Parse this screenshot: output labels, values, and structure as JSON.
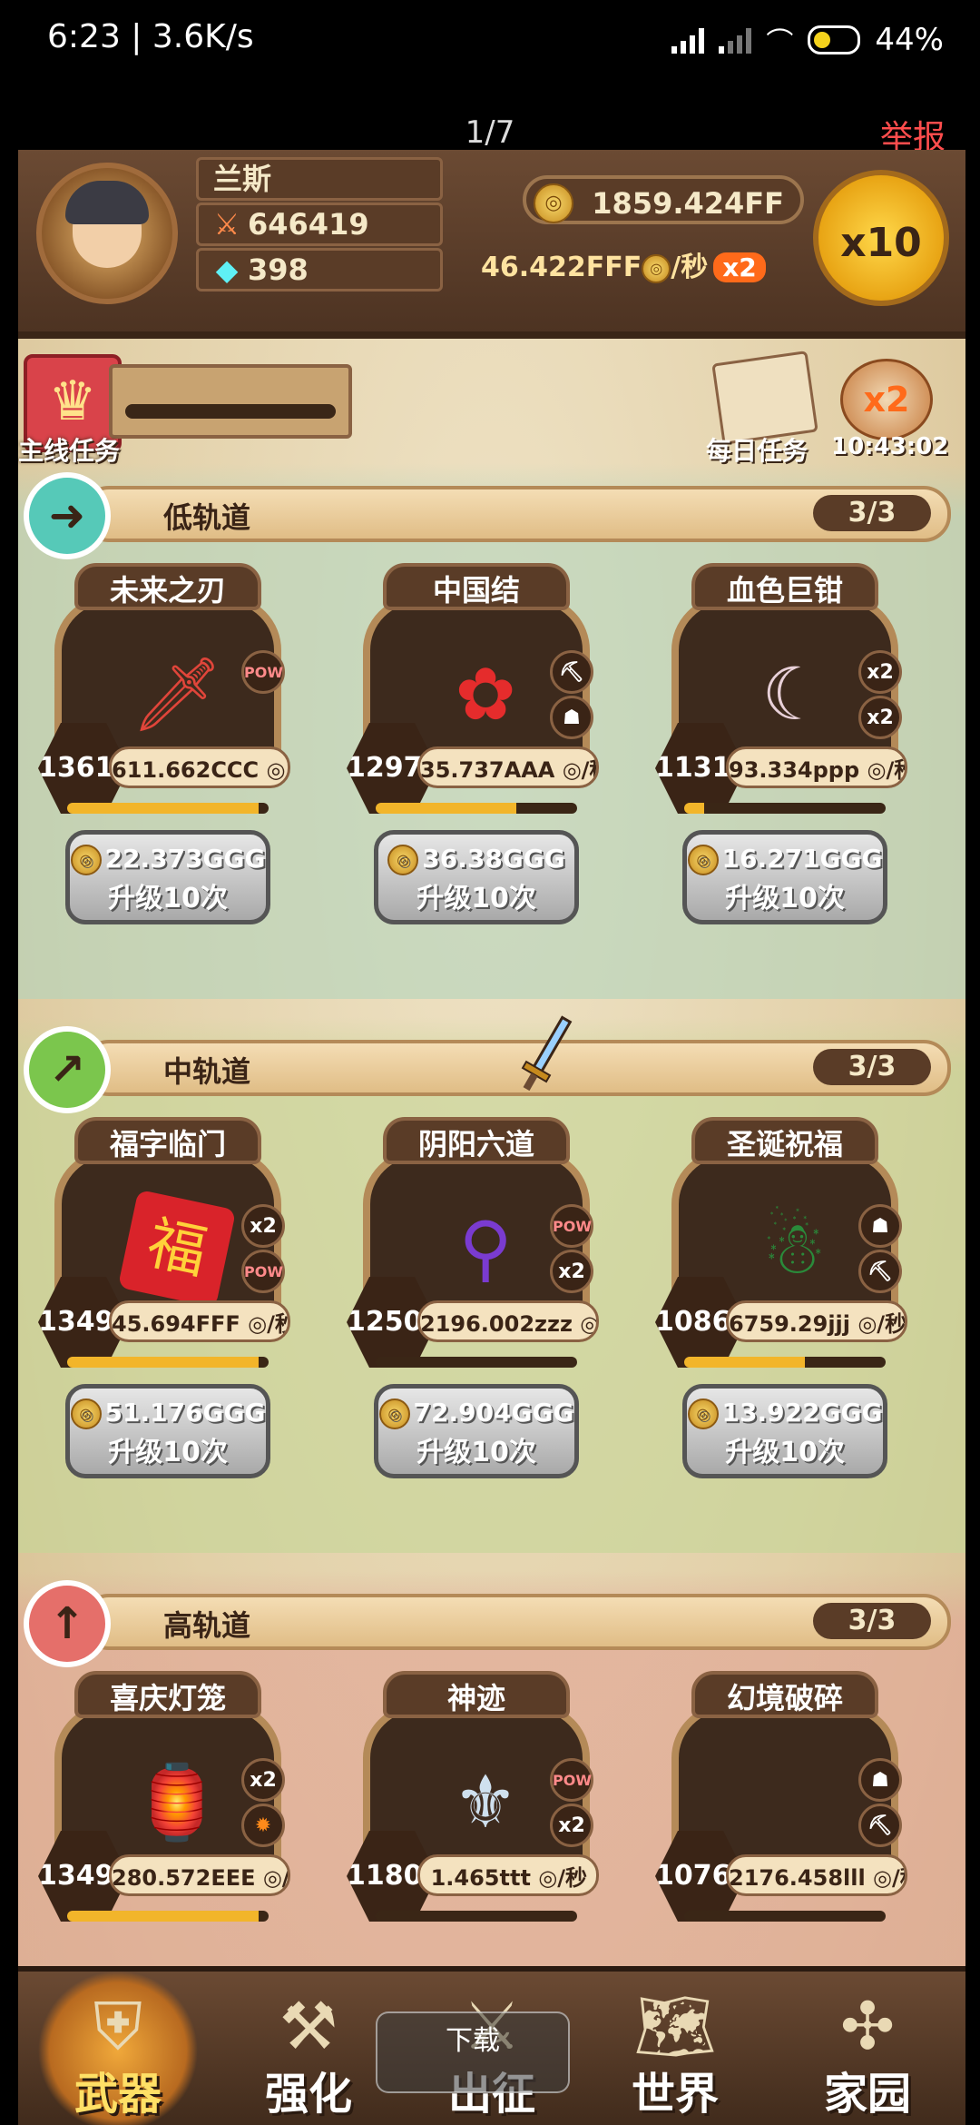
{
  "status_bar": {
    "time": "6:23 | 3.6K/s",
    "battery": "44%"
  },
  "page_bar": {
    "index": "1/7",
    "report": "举报"
  },
  "player": {
    "name": "兰斯",
    "power": "646419",
    "gems": "398",
    "coins": "1859.424FF",
    "rate": "46.422FFF",
    "rate_unit": "/秒",
    "rate_boost": "x2",
    "multiplier": "x10"
  },
  "quests": {
    "main_label": "主线任务",
    "daily_label": "每日任务",
    "boost_label": "x2",
    "boost_timer": "10:43:02"
  },
  "tracks": [
    {
      "name": "低轨道",
      "count": "3/3",
      "icon": "arrow-right-icon",
      "cards": [
        {
          "title": "未来之刃",
          "level": "13610",
          "earn": "611.662CCC",
          "cost": "22.373GGG",
          "action": "升级10次",
          "progress": 0.95,
          "badges": [
            "POW"
          ],
          "item_icon": "sword-icon"
        },
        {
          "title": "中国结",
          "level": "12970",
          "earn": "35.737AAA",
          "cost": "36.38GGG",
          "action": "升级10次",
          "progress": 0.7,
          "badges": [
            "axe",
            "shadow"
          ],
          "item_icon": "chinese-knot-icon"
        },
        {
          "title": "血色巨钳",
          "level": "11310",
          "earn": "93.334ppp",
          "cost": "16.271GGG",
          "action": "升级10次",
          "progress": 0.1,
          "badges": [
            "x2",
            "x2"
          ],
          "item_icon": "claw-icon"
        }
      ]
    },
    {
      "name": "中轨道",
      "count": "3/3",
      "icon": "arrow-up-right-icon",
      "cards": [
        {
          "title": "福字临门",
          "level": "13490",
          "earn": "45.694FFF",
          "cost": "51.176GGG",
          "action": "升级10次",
          "progress": 0.95,
          "badges": [
            "x2",
            "POW"
          ],
          "item_icon": "fu-icon"
        },
        {
          "title": "阴阳六道",
          "level": "12500",
          "earn": "2196.002zzz",
          "cost": "72.904GGG",
          "action": "升级10次",
          "progress": 0.0,
          "badges": [
            "POW",
            "x2"
          ],
          "item_icon": "staff-icon"
        },
        {
          "title": "圣诞祝福",
          "level": "10860",
          "earn": "6759.29jjj",
          "cost": "13.922GGG",
          "action": "升级10次",
          "progress": 0.6,
          "badges": [
            "shadow",
            "axe"
          ],
          "item_icon": "christmas-book-icon"
        }
      ]
    },
    {
      "name": "高轨道",
      "count": "3/3",
      "icon": "arrow-up-icon",
      "cards": [
        {
          "title": "喜庆灯笼",
          "level": "13490",
          "earn": "280.572EEE",
          "cost": "",
          "action": "",
          "progress": 0.95,
          "badges": [
            "x2",
            "fire"
          ],
          "item_icon": "lantern-icon"
        },
        {
          "title": "神迹",
          "level": "11800",
          "earn": "1.465ttt",
          "cost": "",
          "action": "",
          "progress": 0.0,
          "badges": [
            "POW",
            "x2"
          ],
          "item_icon": "trident-icon"
        },
        {
          "title": "幻境破碎",
          "level": "10760",
          "earn": "2176.458lll",
          "cost": "",
          "action": "",
          "progress": 0.0,
          "badges": [
            "shadow",
            "axe"
          ],
          "item_icon": "shadow-icon"
        }
      ]
    }
  ],
  "nav": [
    {
      "label": "武器",
      "icon": "weapon-icon",
      "active": true
    },
    {
      "label": "强化",
      "icon": "hammer-icon",
      "active": false
    },
    {
      "label": "出征",
      "icon": "crossed-swords-icon",
      "active": false
    },
    {
      "label": "世界",
      "icon": "map-icon",
      "active": false
    },
    {
      "label": "家园",
      "icon": "windmill-icon",
      "active": false
    }
  ],
  "download_label": "下载",
  "colors": {
    "report": "#ff4d4d",
    "accent": "#f2b52a",
    "frame": "#b48a58"
  }
}
